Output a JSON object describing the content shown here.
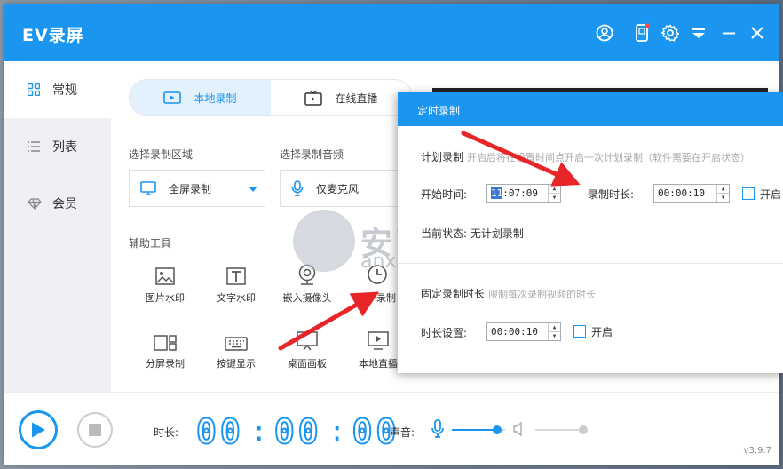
{
  "app": {
    "title": "EV录屏",
    "version": "v3.9.7"
  },
  "sidebar": {
    "items": [
      {
        "label": "常规",
        "icon": "grid-icon",
        "active": true
      },
      {
        "label": "列表",
        "icon": "list-icon",
        "active": false
      },
      {
        "label": "会员",
        "icon": "diamond-icon",
        "active": false
      }
    ]
  },
  "tabs": [
    {
      "label": "本地录制",
      "icon": "video-camera-icon",
      "active": true
    },
    {
      "label": "在线直播",
      "icon": "tv-icon",
      "active": false
    }
  ],
  "capture": {
    "area_label": "选择录制区域",
    "area_value": "全屏录制",
    "audio_label": "选择录制音频",
    "audio_value": "仅麦克风"
  },
  "tools": {
    "label": "辅助工具",
    "items": [
      {
        "label": "图片水印",
        "icon": "image-icon"
      },
      {
        "label": "文字水印",
        "icon": "text-icon"
      },
      {
        "label": "嵌入摄像头",
        "icon": "webcam-icon"
      },
      {
        "label": "录制",
        "icon": "clock-icon"
      },
      {
        "label": "分屏录制",
        "icon": "split-screen-icon"
      },
      {
        "label": "按键显示",
        "icon": "keyboard-icon"
      },
      {
        "label": "桌面画板",
        "icon": "whiteboard-icon"
      },
      {
        "label": "本地直播",
        "icon": "local-live-icon"
      }
    ]
  },
  "bottom": {
    "duration_label": "时长:",
    "timer": [
      "00",
      "00",
      "00"
    ],
    "sound_label": "声音:",
    "mic_level": 0.85,
    "speaker_level": 1.0
  },
  "dialog": {
    "title": "定时录制",
    "scheduled": {
      "title": "计划录制",
      "hint": "开启后将在设置时间点开启一次计划录制（软件需要在开启状态）",
      "start_label": "开始时间:",
      "start_hour": "11",
      "start_rest": ":07:09",
      "duration_label": "录制时长:",
      "duration_value": "00:00:10",
      "enable_label": "开启",
      "status_label": "当前状态:",
      "status_value": "无计划录制"
    },
    "fixed": {
      "title": "固定录制时长",
      "hint": "限制每次录制视频的时长",
      "duration_label": "时长设置:",
      "duration_value": "00:00:10",
      "enable_label": "开启"
    }
  },
  "watermark": {
    "text": "安下载",
    "url": "anxz.com"
  },
  "colors": {
    "accent": "#1a96f0",
    "arrow": "#e8262a"
  }
}
